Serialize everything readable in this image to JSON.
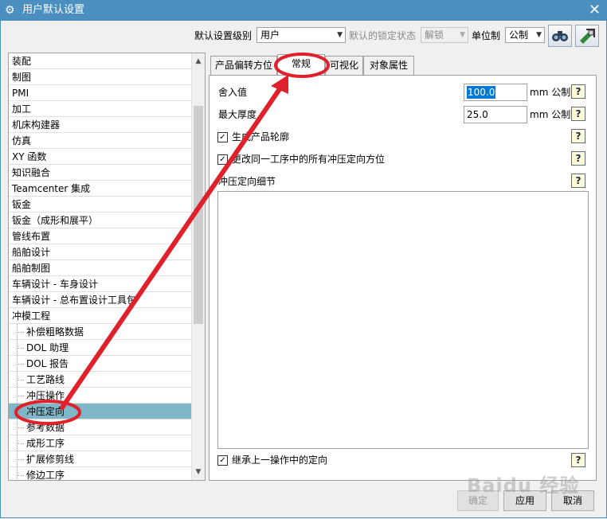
{
  "window": {
    "title": "用户默认设置",
    "close_glyph": "✕",
    "icon": "gear-icon"
  },
  "toolbar": {
    "level_label": "默认设置级别",
    "level_value": "用户",
    "lock_label": "默认的锁定状态",
    "lock_value": "解锁",
    "units_label": "单位制",
    "units_value": "公制",
    "btn1_icon": "find-icon",
    "btn2_icon": "import-export-icon"
  },
  "tree": {
    "items": [
      "装配",
      "制图",
      "PMI",
      "加工",
      "机床构建器",
      "仿真",
      "XY 函数",
      "知识融合",
      "Teamcenter 集成",
      "钣金",
      "钣金（成形和展平）",
      "管线布置",
      "船舶设计",
      "船舶制图",
      "车辆设计 - 车身设计",
      "车辆设计 - 总布置设计工具包",
      "冲模工程"
    ],
    "children": [
      "补偿粗略数据",
      "DOL 助理",
      "DOL 报告",
      "工艺路线",
      "冲压操作",
      "冲压定向",
      "参考数据",
      "成形工序",
      "扩展修剪线",
      "修边工序"
    ],
    "selected_child": "冲压定向"
  },
  "tabs": [
    "产品偏转方位",
    "常规",
    "可视化",
    "对象属性"
  ],
  "active_tab": "常规",
  "form": {
    "rounding_label": "舍入值",
    "rounding_value": "100.0",
    "rounding_unit": "mm 公制",
    "max_thickness_label": "最大厚度",
    "max_thickness_value": "25.0",
    "max_thickness_unit": "mm 公制",
    "generate_outline_label": "生成产品轮廓",
    "generate_outline_checked": true,
    "change_all_label": "更改同一工序中的所有冲压定向方位",
    "change_all_checked": true,
    "details_label": "冲压定向细节",
    "details_value": "",
    "inherit_label": "继承上一操作中的定向",
    "inherit_checked": true,
    "help_glyph": "?"
  },
  "buttons": {
    "ok": "确定",
    "apply": "应用",
    "cancel": "取消"
  },
  "watermark": "Baidu 经验",
  "annotation_color": "#e0202a",
  "selection_color": "#7fb6c8",
  "titlebar_color": "#4a8fbf"
}
